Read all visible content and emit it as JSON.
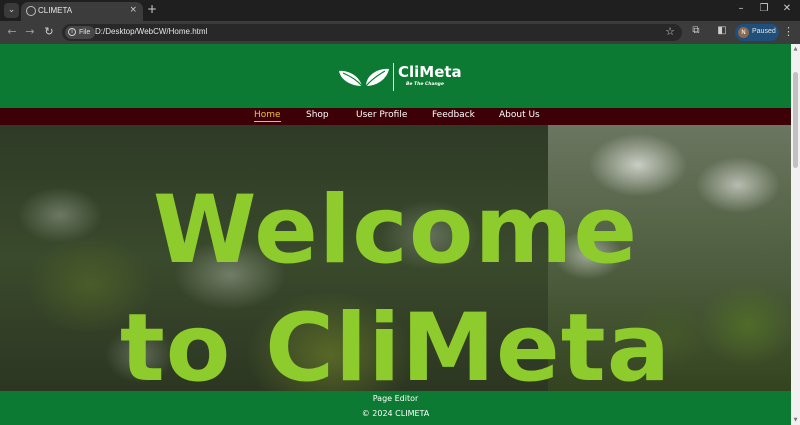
{
  "browser": {
    "tab": {
      "title": "CLIMETA",
      "close": "×"
    },
    "new_tab": "+",
    "window": {
      "minimize": "–",
      "restore": "❐",
      "close": "✕"
    },
    "nav": {
      "back": "←",
      "forward": "→",
      "reload": "↻"
    },
    "site_chip": "File",
    "url": "D:/Desktop/WebCW/Home.html",
    "bookmark": "☆",
    "extensions": "⧉",
    "side_panel": "◧",
    "profile": {
      "initial": "N",
      "label": "Paused"
    },
    "menu": "⋮"
  },
  "header": {
    "brand_name": "CliMeta",
    "tagline": "Be The Change"
  },
  "nav": {
    "items": [
      {
        "label": "Home",
        "active": true
      },
      {
        "label": "Shop",
        "active": false
      },
      {
        "label": "User Profile",
        "active": false
      },
      {
        "label": "Feedback",
        "active": false
      },
      {
        "label": "About Us",
        "active": false
      }
    ]
  },
  "hero": {
    "line1": "Welcome",
    "line2": "to CliMeta"
  },
  "footer": {
    "link": "Page Editor",
    "copyright": "© 2024 CLIMETA"
  },
  "colors": {
    "header_green": "#0c7a32",
    "nav_maroon": "#3d0006",
    "active_yellow": "#f2c12e",
    "hero_text_green": "#8ecb2c"
  }
}
